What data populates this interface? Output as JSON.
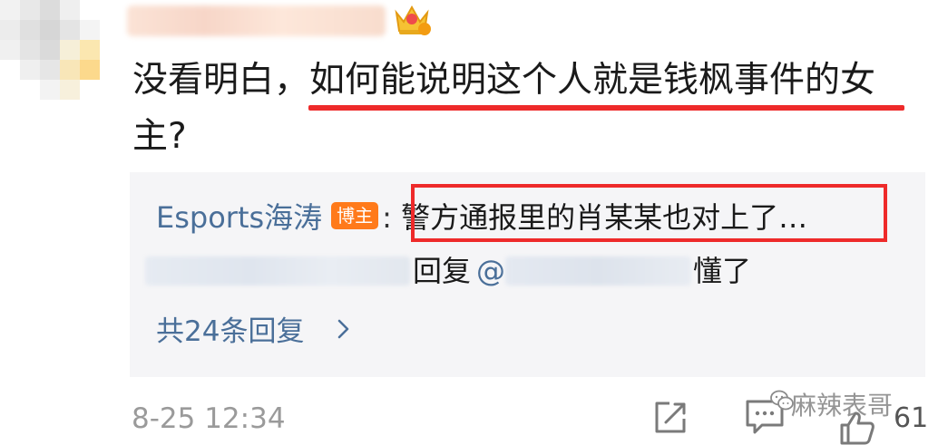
{
  "comment": {
    "text_plain": "没看明白，",
    "text_highlight": "如何能说明这个人就是钱枫事件的女",
    "text_tail": "主?"
  },
  "reply": {
    "author": "Esports海涛",
    "badge": "博主",
    "colon": ":",
    "text": "警方通报里的肖某某也对上了…",
    "second_reply_prefix": "回复",
    "second_reply_at": "@",
    "second_reply_text": "懂了",
    "more_link": "共24条回复"
  },
  "footer": {
    "timestamp": "8-25 12:34",
    "like_count": "61",
    "watermark": "麻辣表哥"
  },
  "colors": {
    "highlight_red": "#ee2a2a",
    "link_blue": "#4a6f99",
    "badge_orange": "#ff7a1a",
    "reply_bg": "#f5f5f7"
  },
  "icons": [
    "crown-badge-icon",
    "chevron-right-icon",
    "share-icon",
    "comment-icon",
    "wechat-icon",
    "like-icon"
  ]
}
